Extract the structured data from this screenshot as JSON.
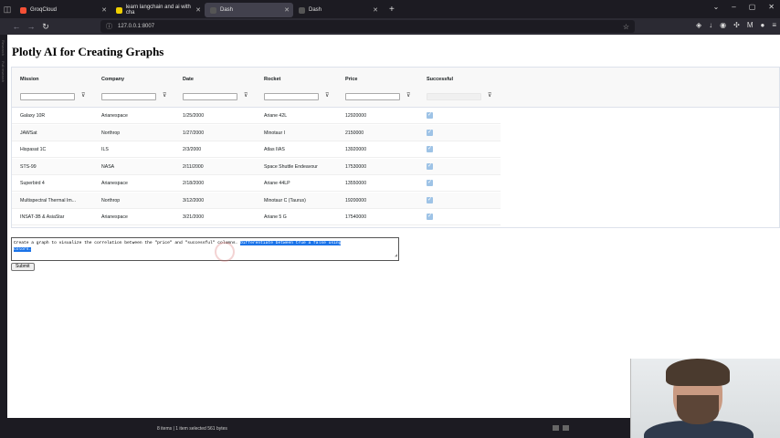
{
  "browser": {
    "tabs": [
      {
        "label": "GroqCloud",
        "color": "#f55036",
        "active": false
      },
      {
        "label": "learn langchain and ai with cha",
        "color": "#f0d000",
        "active": false
      },
      {
        "label": "Dash",
        "color": "#1f77b4",
        "active": true
      },
      {
        "label": "Dash",
        "color": "#1f77b4",
        "active": false
      }
    ],
    "url": "127.0.0.1:8007"
  },
  "page": {
    "title": "Plotly AI for Creating Graphs"
  },
  "grid": {
    "columns": [
      "Mission",
      "Company",
      "Date",
      "Rocket",
      "Price",
      "Successful"
    ],
    "rows": [
      {
        "mission": "Galaxy 10R",
        "company": "Arianespace",
        "date": "1/25/2000",
        "rocket": "Ariane 42L",
        "price": "12920000",
        "successful": true
      },
      {
        "mission": "JAWSat",
        "company": "Northrop",
        "date": "1/27/2000",
        "rocket": "Minotaur I",
        "price": "2150000",
        "successful": true
      },
      {
        "mission": "Hispasat 1C",
        "company": "ILS",
        "date": "2/3/2000",
        "rocket": "Atlas IIAS",
        "price": "13920000",
        "successful": true
      },
      {
        "mission": "STS-99",
        "company": "NASA",
        "date": "2/11/2000",
        "rocket": "Space Shuttle Endeavour",
        "price": "17530000",
        "successful": true
      },
      {
        "mission": "Superbird 4",
        "company": "Arianespace",
        "date": "2/18/2000",
        "rocket": "Ariane 44LP",
        "price": "13550000",
        "successful": true
      },
      {
        "mission": "Multispectral Thermal Im...",
        "company": "Northrop",
        "date": "3/12/2000",
        "rocket": "Minotaur C (Taurus)",
        "price": "19200000",
        "successful": true
      },
      {
        "mission": "INSAT-3B & AsiaStar",
        "company": "Arianespace",
        "date": "3/21/2000",
        "rocket": "Ariane 5 G",
        "price": "17540000",
        "successful": true
      }
    ]
  },
  "prompt": {
    "text_plain": "Create a graph to visualize the correlation between the \"price\" and \"successful\" columns. ",
    "text_selected_1": "Differentiate between true a false using",
    "text_selected_2": "colors."
  },
  "submit_label": "Submit",
  "status": {
    "text": "8 items  |  1 item selected  561 bytes"
  }
}
